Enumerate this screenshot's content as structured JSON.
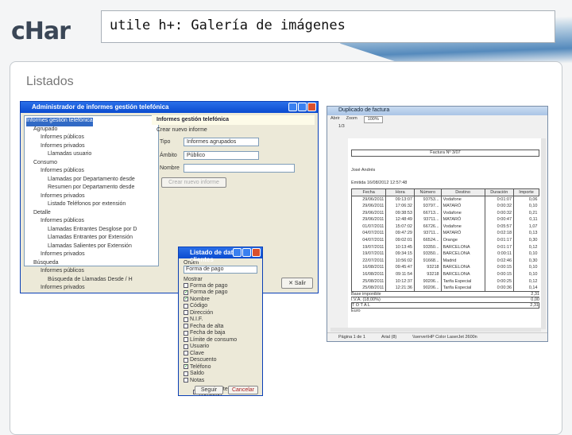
{
  "logo": "cHar",
  "title": "utile h+: Galería de imágenes",
  "section": "Listados",
  "admin": {
    "title": "Administrador de informes gestión telefónica",
    "tree": [
      "Informes gestión telefónica",
      "Agrupado",
      "Informes públicos",
      "Informes privados",
      "Llamadas usuario",
      "Consumo",
      "Informes públicos",
      "Llamadas por Departamento desde",
      "Resumen por Departamento desde",
      "Informes privados",
      "Listado Teléfonos por extensión",
      "Detalle",
      "Informes públicos",
      "Llamadas Entrantes Desglose por D",
      "Llamadas Entrantes por Extensión",
      "Llamadas Salientes por Extensión",
      "Informes privados",
      "Búsqueda",
      "Informes públicos",
      "Búsqueda de Llamadas Desde / H",
      "Informes privados"
    ],
    "panel_title": "Informes gestión telefónica",
    "group_label": "Crear nuevo informe",
    "tipo_label": "Tipo",
    "tipo_value": "Informes agrupados",
    "ambito_label": "Ámbito",
    "ambito_value": "Público",
    "nombre_label": "Nombre",
    "nombre_value": "",
    "create_button": "Crear nuevo informe",
    "exit_button": "Salir"
  },
  "dialog": {
    "title": "Listado de datos clientes",
    "order_label": "Orden",
    "order_value": "Forma de pago",
    "show_label": "Mostrar",
    "fields": [
      {
        "label": "Forma de pago",
        "checked": false
      },
      {
        "label": "Forma de pago",
        "checked": true
      },
      {
        "label": "Nombre",
        "checked": true
      },
      {
        "label": "Código",
        "checked": false
      },
      {
        "label": "Dirección",
        "checked": false
      },
      {
        "label": "N.I.F.",
        "checked": false
      },
      {
        "label": "Fecha de alta",
        "checked": false
      },
      {
        "label": "Fecha de baja",
        "checked": false
      },
      {
        "label": "Límite de consumo",
        "checked": false
      },
      {
        "label": "Usuario",
        "checked": false
      },
      {
        "label": "Clave",
        "checked": false
      },
      {
        "label": "Descuento",
        "checked": false
      },
      {
        "label": "Teléfono",
        "checked": true
      },
      {
        "label": "Saldo",
        "checked": false
      },
      {
        "label": "Notas",
        "checked": false
      }
    ],
    "only_label": "Solo clientes con consumo",
    "next_button": "Seguir",
    "cancel_button": "Cancelar"
  },
  "invoice": {
    "title": "Duplicado de factura",
    "toolbar": [
      "Abrir",
      "Zoom",
      "100%"
    ],
    "tab": "1/3",
    "heading": "Factura Nº 3/07",
    "client": "José Andrés",
    "issued": "Emitida 16/08/2012 12:57:48",
    "columns": [
      "Fecha",
      "Hora",
      "Número",
      "Destino",
      "Duración",
      "Importe"
    ],
    "rows": [
      [
        "29/06/2011",
        "09:13:07",
        "93753...",
        "Vodafone",
        "0:01:07",
        "0,06"
      ],
      [
        "29/06/2011",
        "17:06:32",
        "93797...",
        "MATARÓ",
        "0:00:32",
        "0,10"
      ],
      [
        "29/06/2011",
        "09:38:53",
        "66713...",
        "Vodafone",
        "0:00:32",
        "0,21"
      ],
      [
        "29/06/2011",
        "12:48:49",
        "93711...",
        "MATARÓ",
        "0:00:47",
        "0,11"
      ],
      [
        "01/07/2011",
        "15:07:02",
        "66726...",
        "Vodafone",
        "0:05:57",
        "1,07"
      ],
      [
        "04/07/2011",
        "09:47:29",
        "93711...",
        "MATARÓ",
        "0:02:18",
        "0,13"
      ],
      [
        "04/07/2011",
        "09:02:01",
        "66524...",
        "Orange",
        "0:01:17",
        "0,30"
      ],
      [
        "19/07/2011",
        "10:13:45",
        "93350...",
        "BARCELONA",
        "0:01:17",
        "0,12"
      ],
      [
        "19/07/2011",
        "09:34:15",
        "93350...",
        "BARCELONA",
        "0:00:11",
        "0,10"
      ],
      [
        "22/07/2011",
        "10:56:02",
        "91668...",
        "Madrid",
        "0:02:46",
        "0,30"
      ],
      [
        "16/08/2011",
        "09:45:47",
        "93218",
        "BARCELONA",
        "0:00:15",
        "0,10"
      ],
      [
        "16/08/2011",
        "09:11:54",
        "93218",
        "BARCELONA",
        "0:00:15",
        "0,10"
      ],
      [
        "25/08/2011",
        "10:12:37",
        "90206...",
        "Tarifa Especial",
        "0:00:25",
        "0,12"
      ],
      [
        "25/08/2011",
        "12:21:36",
        "90206...",
        "Tarifa Especial",
        "0:00:36",
        "0,14"
      ]
    ],
    "base_label": "Base imponible",
    "base_value": "2,31",
    "iva_label": "I.V.A. (18,00%)",
    "iva_value": "0,00",
    "total_label": "T O T A L",
    "total_value": "2,31",
    "currency": "Euro",
    "status": [
      "Página 1 de 1",
      "Arial (8)",
      "\\\\server\\HP Color LaserJet 2600n"
    ]
  }
}
